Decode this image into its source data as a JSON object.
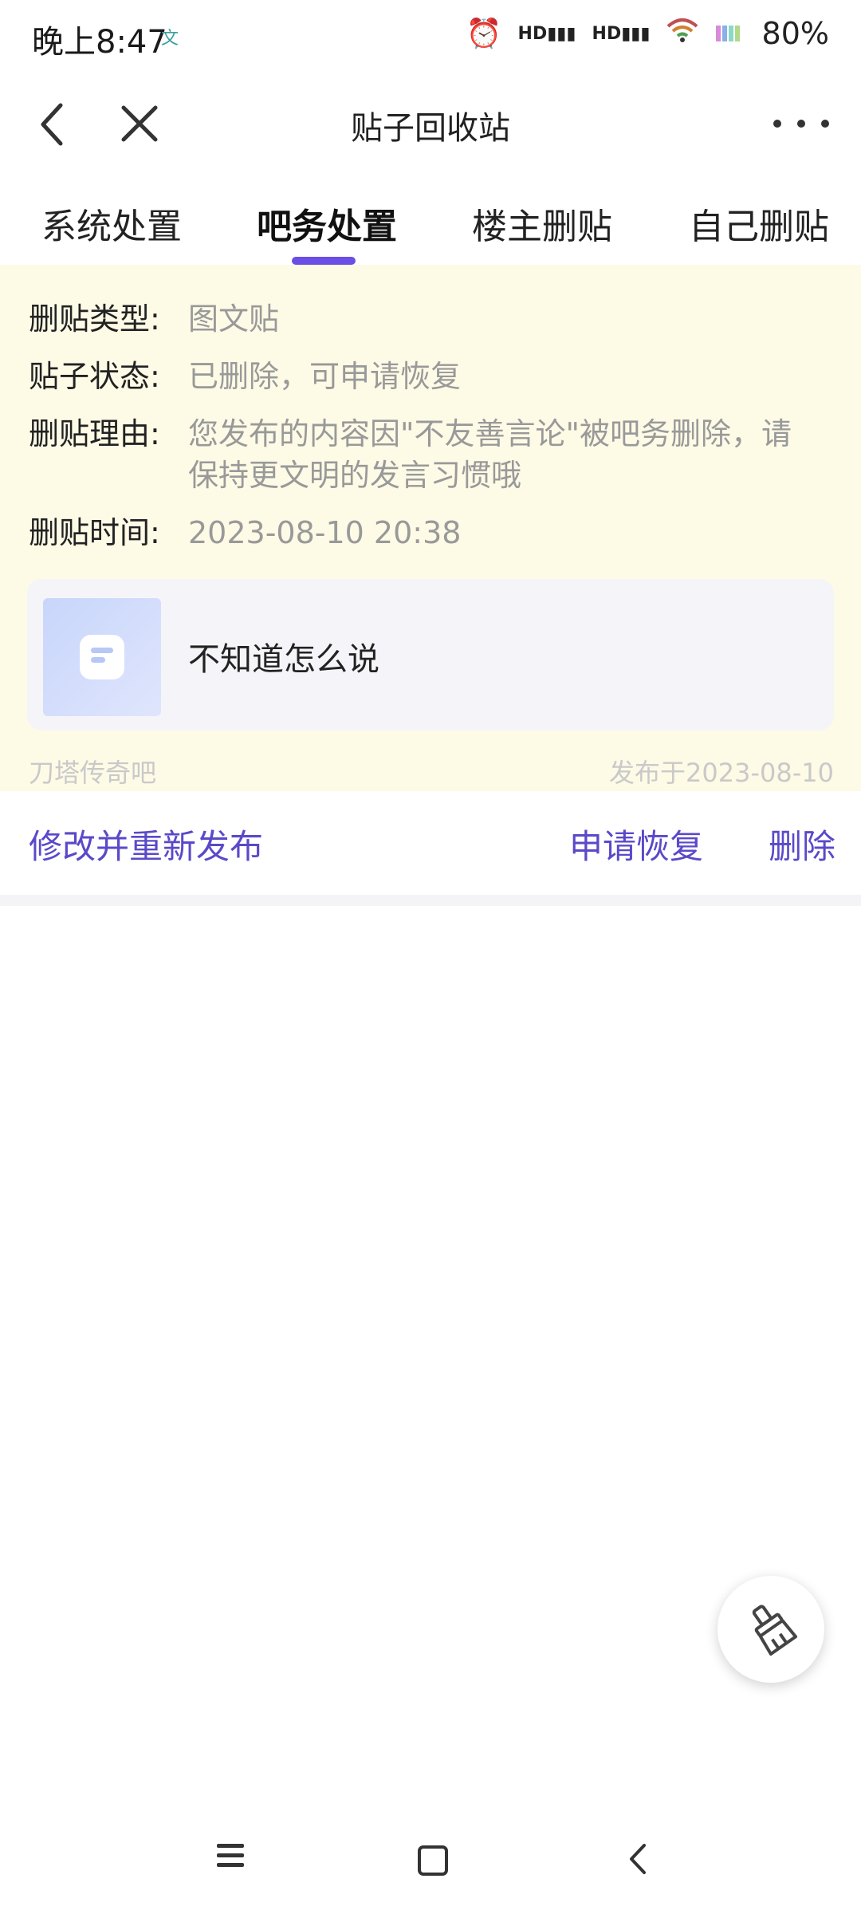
{
  "status_bar": {
    "time": "晚上8:47",
    "battery": "80%"
  },
  "header": {
    "title": "贴子回收站"
  },
  "tabs": [
    {
      "label": "系统处置"
    },
    {
      "label": "吧务处置",
      "active": true
    },
    {
      "label": "楼主删贴"
    },
    {
      "label": "自己删贴"
    }
  ],
  "details": {
    "type_label": "删贴类型:",
    "type_value": "图文贴",
    "status_label": "贴子状态:",
    "status_value": "已删除，可申请恢复",
    "reason_label": "删贴理由:",
    "reason_value": "您发布的内容因\"不友善言论\"被吧务删除，请保持更文明的发言习惯哦",
    "time_label": "删贴时间:",
    "time_value": "2023-08-10 20:38"
  },
  "post": {
    "title": "不知道怎么说",
    "forum": "刀塔传奇吧",
    "published": "发布于2023-08-10"
  },
  "actions": {
    "edit_repost": "修改并重新发布",
    "apply_restore": "申请恢复",
    "delete": "删除"
  },
  "colors": {
    "accent": "#5a49c9",
    "tab_indicator": "#6b4ee6",
    "panel_bg": "#fdfae6"
  }
}
